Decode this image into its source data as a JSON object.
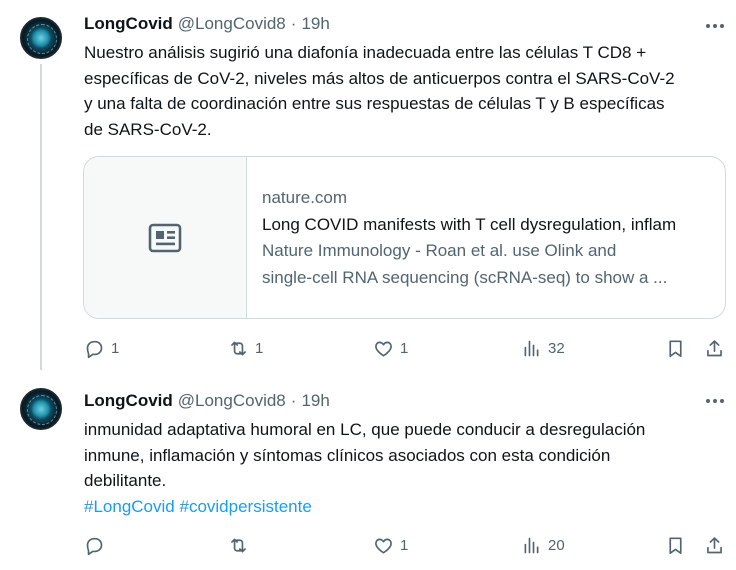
{
  "tweets": [
    {
      "author": {
        "name": "LongCovid",
        "handle": "@LongCovid8",
        "separator": "·",
        "time": "19h"
      },
      "text_lines": [
        "Nuestro análisis sugirió una diafonía inadecuada entre las células T CD8 +",
        "específicas de CoV-2, niveles más altos de anticuerpos contra el SARS-CoV-2",
        "y una falta de coordinación entre sus respuestas de células T y B específicas",
        "de SARS-CoV-2."
      ],
      "card": {
        "domain": "nature.com",
        "title": "Long COVID manifests with T cell dysregulation, inflam",
        "description_lines": [
          "Nature Immunology - Roan et al. use Olink and",
          "single-cell RNA sequencing (scRNA-seq) to show a ..."
        ],
        "media_icon": "article-icon"
      },
      "actions": {
        "replies": "1",
        "reposts": "1",
        "likes": "1",
        "views": "32"
      }
    },
    {
      "author": {
        "name": "LongCovid",
        "handle": "@LongCovid8",
        "separator": "·",
        "time": "19h"
      },
      "text_lines": [
        "inmunidad adaptativa humoral en LC, que puede conducir a desregulación",
        "inmune, inflamación y síntomas clínicos asociados con esta condición",
        "debilitante."
      ],
      "hashtags": [
        "#LongCovid",
        "#covidpersistente"
      ],
      "actions": {
        "replies": "",
        "reposts": "",
        "likes": "1",
        "views": "20"
      }
    }
  ],
  "colors": {
    "text": "#0f1419",
    "secondary": "#536471",
    "link": "#1d9bf0",
    "border": "#cfd9de"
  }
}
